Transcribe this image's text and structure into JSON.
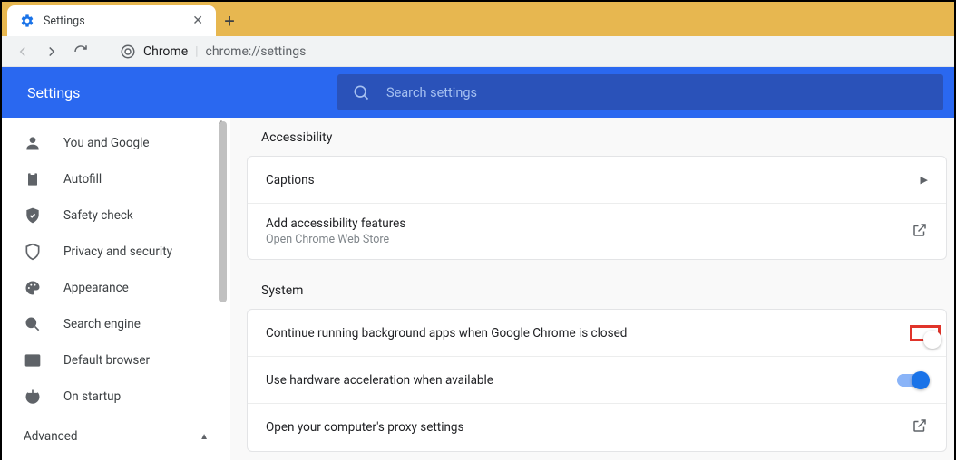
{
  "browser": {
    "tab_title": "Settings",
    "url_origin": "Chrome",
    "url_path": "chrome://settings"
  },
  "header": {
    "title": "Settings",
    "search_placeholder": "Search settings"
  },
  "sidebar": {
    "items": [
      {
        "id": "you-and-google",
        "label": "You and Google"
      },
      {
        "id": "autofill",
        "label": "Autofill"
      },
      {
        "id": "safety-check",
        "label": "Safety check"
      },
      {
        "id": "privacy",
        "label": "Privacy and security"
      },
      {
        "id": "appearance",
        "label": "Appearance"
      },
      {
        "id": "search-engine",
        "label": "Search engine"
      },
      {
        "id": "default-browser",
        "label": "Default browser"
      },
      {
        "id": "on-startup",
        "label": "On startup"
      }
    ],
    "advanced_label": "Advanced"
  },
  "sections": {
    "accessibility": {
      "title": "Accessibility",
      "captions": "Captions",
      "add_features": "Add accessibility features",
      "add_features_sub": "Open Chrome Web Store"
    },
    "system": {
      "title": "System",
      "bg_apps": "Continue running background apps when Google Chrome is closed",
      "bg_apps_on": false,
      "hw_accel": "Use hardware acceleration when available",
      "hw_accel_on": true,
      "proxy": "Open your computer's proxy settings"
    }
  }
}
